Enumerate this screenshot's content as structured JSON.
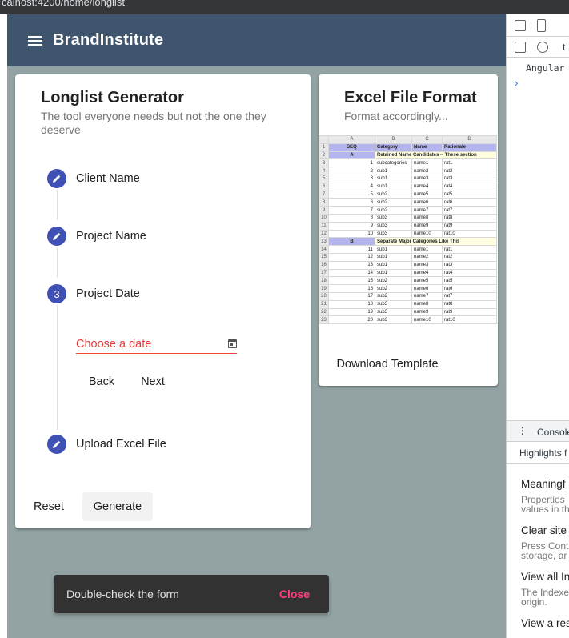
{
  "browser": {
    "url": "calhost:4200/home/longlist"
  },
  "app": {
    "brand": "BrandInstitute"
  },
  "generator_card": {
    "title": "Longlist Generator",
    "subtitle_line1": "The tool everyone needs but not the one they",
    "subtitle_line2": "deserve",
    "steps": [
      {
        "label": "Client Name",
        "state": "edit",
        "icon": "pencil-icon"
      },
      {
        "label": "Project Name",
        "state": "edit",
        "icon": "pencil-icon"
      },
      {
        "label": "Project Date",
        "state": "active",
        "number": "3"
      },
      {
        "label": "Upload Excel File",
        "state": "edit",
        "icon": "pencil-icon"
      }
    ],
    "date_placeholder": "Choose a date",
    "back_label": "Back",
    "next_label": "Next",
    "reset_label": "Reset",
    "generate_label": "Generate"
  },
  "excel_card": {
    "title": "Excel File Format",
    "subtitle": "Format accordingly...",
    "download_label": "Download Template",
    "sheet": {
      "columns": [
        "A",
        "B",
        "C",
        "D"
      ],
      "header": [
        "SEQ",
        "Category",
        "Name",
        "Rationale"
      ],
      "row2": [
        "A",
        "Retained Name Candidates -- These section"
      ],
      "rows_a": [
        [
          "1",
          "subcategories",
          "name1",
          "rat1"
        ],
        [
          "2",
          "sub1",
          "name2",
          "rat2"
        ],
        [
          "3",
          "sub1",
          "name3",
          "rat3"
        ],
        [
          "4",
          "sub1",
          "name4",
          "rat4"
        ],
        [
          "5",
          "sub2",
          "name5",
          "rat5"
        ],
        [
          "6",
          "sub2",
          "name6",
          "rat6"
        ],
        [
          "7",
          "sub2",
          "name7",
          "rat7"
        ],
        [
          "8",
          "sub3",
          "name8",
          "rat8"
        ],
        [
          "9",
          "sub3",
          "name9",
          "rat9"
        ],
        [
          "10",
          "sub3",
          "name10",
          "rat10"
        ]
      ],
      "row13": [
        "B",
        "Separate Major Categories Like This"
      ],
      "rows_b": [
        [
          "11",
          "sub1",
          "name1",
          "rat1"
        ],
        [
          "12",
          "sub1",
          "name2",
          "rat2"
        ],
        [
          "13",
          "sub1",
          "name3",
          "rat3"
        ],
        [
          "14",
          "sub1",
          "name4",
          "rat4"
        ],
        [
          "15",
          "sub2",
          "name5",
          "rat5"
        ],
        [
          "16",
          "sub2",
          "name6",
          "rat6"
        ],
        [
          "17",
          "sub2",
          "name7",
          "rat7"
        ],
        [
          "18",
          "sub3",
          "name8",
          "rat8"
        ],
        [
          "19",
          "sub3",
          "name9",
          "rat9"
        ],
        [
          "20",
          "sub3",
          "name10",
          "rat10"
        ]
      ]
    }
  },
  "snackbar": {
    "message": "Double-check the form",
    "action": "Close"
  },
  "devtools": {
    "console_filter": "Angular",
    "tab_console": "Console",
    "highlights": "Highlights f",
    "items": [
      {
        "title": "Meaningf",
        "line1": "Properties",
        "line2": "values in th"
      },
      {
        "title": "Clear site",
        "line1": "Press Cont",
        "line2": "storage, ar"
      },
      {
        "title": "View all In",
        "line1": "The Indexe",
        "line2": "origin."
      },
      {
        "title": "View a res",
        "line1": "",
        "line2": ""
      }
    ]
  },
  "colors": {
    "toolbar": "#3f546d",
    "background": "#93a3a3",
    "step": "#3f51b5",
    "warn": "#f44336",
    "snack_action": "#ff4081"
  }
}
